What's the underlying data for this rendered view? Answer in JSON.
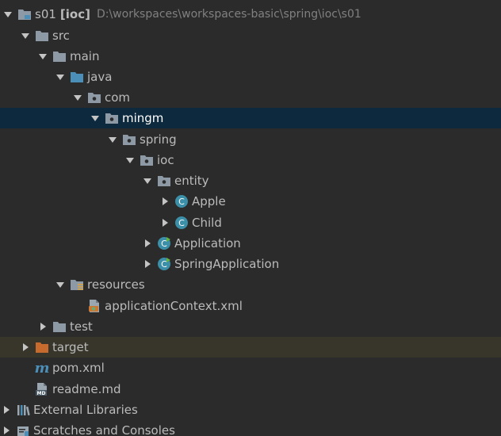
{
  "project_tree": {
    "root": {
      "name": "s01",
      "module": "[ioc]",
      "path": "D:\\workspaces\\workspaces-basic\\spring\\ioc\\s01"
    },
    "src": "src",
    "main": "main",
    "java": "java",
    "com": "com",
    "mingm": "mingm",
    "spring": "spring",
    "ioc": "ioc",
    "entity": "entity",
    "apple": "Apple",
    "child": "Child",
    "application": "Application",
    "spring_application": "SpringApplication",
    "resources": "resources",
    "application_context": "applicationContext.xml",
    "test": "test",
    "target": "target",
    "pom": "pom.xml",
    "readme": "readme.md",
    "external_libraries": "External Libraries",
    "scratches": "Scratches and Consoles"
  },
  "icon_labels": {
    "class_letter": "C",
    "maven_letter": "m",
    "md_badge": "MD"
  },
  "colors": {
    "background": "#2b2b2b",
    "selected_row": "#0d293e",
    "excluded_row": "#38352b",
    "folder": "#8d9aa5",
    "source_folder": "#4b8fb8",
    "excluded_folder": "#c66a2e",
    "class_icon": "#3c8fa8",
    "text": "#bbbbbb",
    "path_text": "#808080"
  }
}
